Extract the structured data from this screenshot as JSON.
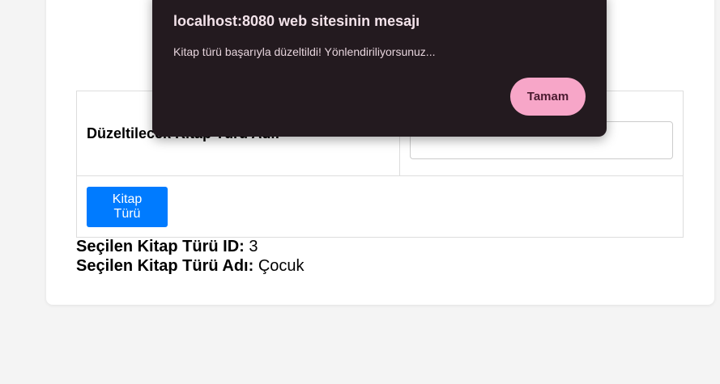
{
  "form": {
    "label": "Düzeltilecek Kitap Türü Adı:",
    "input_value": "",
    "submit_label": "Kitap Türü"
  },
  "info": {
    "id_label": "Seçilen Kitap Türü ID:",
    "id_value": "3",
    "name_label": "Seçilen Kitap Türü Adı:",
    "name_value": "Çocuk"
  },
  "dialog": {
    "title": "localhost:8080 web sitesinin mesajı",
    "message": "Kitap türü başarıyla düzeltildi! Yönlendiriliyorsunuz...",
    "ok_label": "Tamam"
  },
  "colors": {
    "page_bg": "#f4f4f4",
    "button_blue": "#007bff",
    "dialog_bg": "#231a1f",
    "dialog_button": "#f7a6c8"
  }
}
